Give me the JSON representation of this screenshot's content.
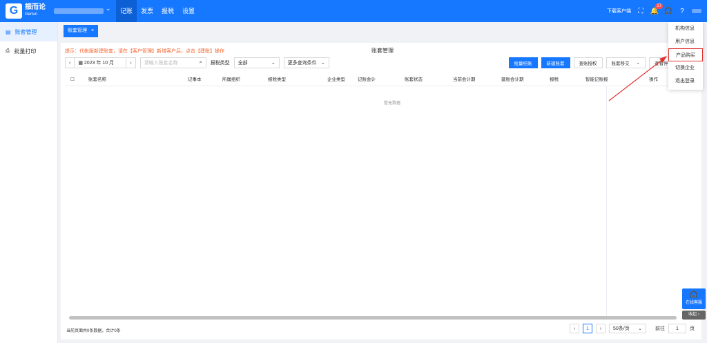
{
  "app": {
    "logo_char": "G",
    "name": "振而论",
    "sub": "Gerlun"
  },
  "nav": {
    "items": [
      "记账",
      "发票",
      "报税",
      "设置"
    ],
    "active": 0
  },
  "header_right": {
    "download": "下载客户端",
    "badge": "27"
  },
  "sidebar": {
    "items": [
      {
        "label": "账套管理",
        "icon": "ledger-icon"
      },
      {
        "label": "批量打印",
        "icon": "printer-icon"
      }
    ]
  },
  "tab": {
    "label": "账套管理",
    "close": "×"
  },
  "page": {
    "tip": "提示：代帐版新建账套，请在【客户管理】新增客户后，点击【建账】操作",
    "title": "账套管理",
    "period": "2023 年 10 月",
    "search_placeholder": "请输入账套名称",
    "tax_type_label": "报税类型",
    "tax_type_value": "全部",
    "more_filters": "更多查询条件",
    "buttons": {
      "batch_tax": "批量结账",
      "new_ledger": "新建账套",
      "check_auth": "查账授权",
      "handover": "账套移交",
      "check_stop": "查看停用"
    },
    "columns": [
      "账套名称",
      "记事本",
      "所属组织",
      "报税类型",
      "企业类型",
      "记账会计",
      "账套状态",
      "当前会计期",
      "建账会计期",
      "报税",
      "智能记账报",
      "操作"
    ],
    "empty": "暂无数据",
    "footer": "当前页面共0条数据，合计0条",
    "pager": {
      "page": "1",
      "size": "50条/页",
      "goto": "前往",
      "goto_value": "1",
      "unit": "页"
    }
  },
  "dropdown": {
    "items": [
      "机构信息",
      "用户信息",
      "产品购买",
      "切换企业",
      "退出登录"
    ],
    "highlight": 2
  },
  "float": {
    "service": "在线客服",
    "collapse": "收起"
  },
  "colors": {
    "primary": "#1677ff",
    "tip": "#f5622d",
    "highlight": "#e03131"
  }
}
